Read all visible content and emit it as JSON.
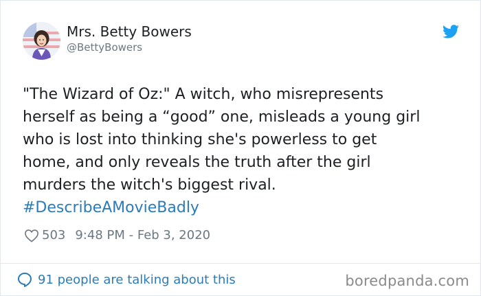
{
  "author": {
    "name": "Mrs. Betty Bowers",
    "handle": "@BettyBowers"
  },
  "tweet": {
    "lines": [
      "\"The Wizard of Oz:\" A witch, who misrepresents",
      "herself as being a “good” one, misleads a young girl",
      "who is lost into thinking she's powerless to get",
      "home, and only reveals the truth after the girl",
      "murders the witch's biggest rival."
    ],
    "hashtag": "#DescribeAMovieBadly"
  },
  "meta": {
    "likes": "503",
    "timestamp": "9:48 PM - Feb 3, 2020"
  },
  "footer": {
    "talking": "91 people are talking about this",
    "watermark": "boredpanda.com"
  },
  "icons": {
    "brand": "twitter-bird-icon",
    "like": "heart-icon",
    "reply": "speech-bubble-icon"
  },
  "colors": {
    "link": "#2b7bb9",
    "text": "#1c2022",
    "muted": "#697882",
    "twitter_blue": "#1da1f2"
  }
}
